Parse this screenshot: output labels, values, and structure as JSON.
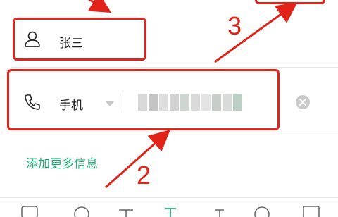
{
  "contact": {
    "name_value": "张三",
    "phone_type_label": "手机",
    "add_more_link": "添加更多信息"
  },
  "annotations": {
    "step_two": "2",
    "step_three": "3",
    "color": "#e2231a"
  },
  "icons": {
    "person": "person-icon",
    "phone": "phone-icon",
    "dropdown": "chevron-down-icon",
    "clear": "clear-icon"
  },
  "colors": {
    "link": "#27b27a",
    "highlight": "#e2231a"
  }
}
